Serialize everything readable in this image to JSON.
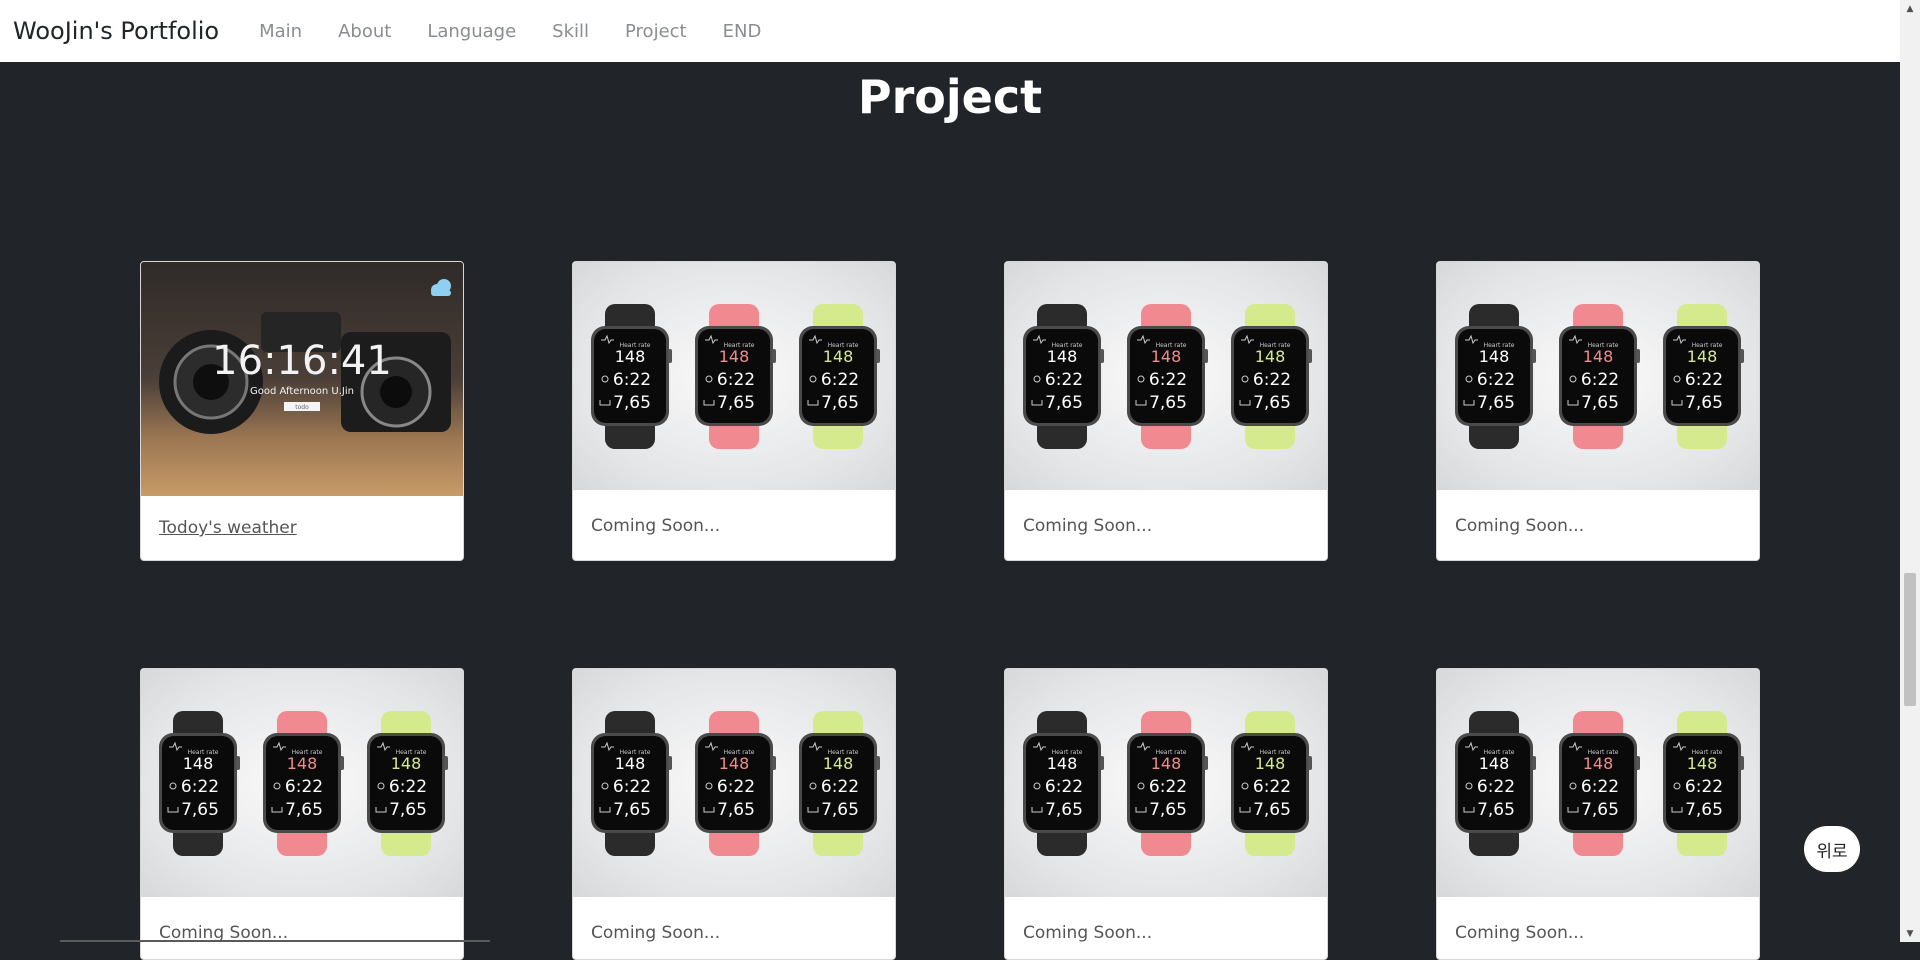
{
  "navbar": {
    "brand": "WooJin's Portfolio",
    "links": [
      "Main",
      "About",
      "Language",
      "Skill",
      "Project",
      "END"
    ]
  },
  "section": {
    "title": "Project"
  },
  "cards": [
    {
      "kind": "camera",
      "label": "Todoy's weather",
      "clock": "16:16:41",
      "greeting": "Good Afternoon U.Jin",
      "input_hint": "todo"
    },
    {
      "kind": "watch",
      "label": "Coming Soon..."
    },
    {
      "kind": "watch",
      "label": "Coming Soon..."
    },
    {
      "kind": "watch",
      "label": "Coming Soon..."
    },
    {
      "kind": "watch",
      "label": "Coming Soon..."
    },
    {
      "kind": "watch",
      "label": "Coming Soon..."
    },
    {
      "kind": "watch",
      "label": "Coming Soon..."
    },
    {
      "kind": "watch",
      "label": "Coming Soon..."
    }
  ],
  "watch_screen": {
    "title": "Heart rate",
    "bpm": "148",
    "time": "6:22",
    "distance": "7,65",
    "bands": [
      "#2b2b2b",
      "#f08a90",
      "#d5ea8c"
    ]
  },
  "top_button": {
    "label": "위로"
  },
  "icons": {
    "weather": "cloud-icon"
  }
}
